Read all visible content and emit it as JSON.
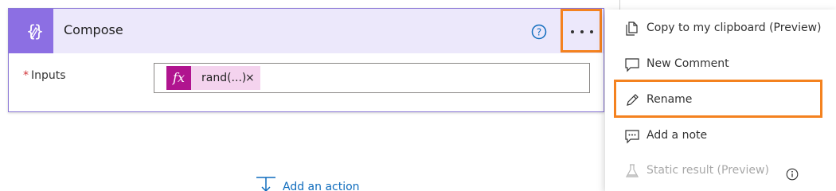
{
  "card": {
    "title": "Compose",
    "inputs_label": "Inputs",
    "required_mark": "*",
    "token": {
      "fx_label": "fx",
      "expression": "rand(...)",
      "remove_glyph": "×"
    },
    "icons": {
      "action": "compose-braces-icon",
      "help": "help-circle-icon",
      "more": "more-ellipsis-icon"
    }
  },
  "add_action": {
    "label": "Add an action",
    "icon": "add-action-icon"
  },
  "menu": {
    "items": [
      {
        "label": "Copy to my clipboard (Preview)",
        "icon": "copy-icon",
        "enabled": true
      },
      {
        "label": "New Comment",
        "icon": "comment-icon",
        "enabled": true
      },
      {
        "label": "Rename",
        "icon": "pencil-icon",
        "enabled": true
      },
      {
        "label": "Add a note",
        "icon": "note-icon",
        "enabled": true
      },
      {
        "label": "Static result (Preview)",
        "icon": "beaker-icon",
        "enabled": false
      }
    ],
    "highlighted_item": "Rename"
  },
  "colors": {
    "accent_purple": "#8c6fe3",
    "header_bg": "#ece8fb",
    "highlight_orange": "#f4821f",
    "fx_magenta": "#b0148f",
    "token_bg": "#f4d3ee",
    "link_blue": "#0f6cbd",
    "required_red": "#d13438"
  }
}
